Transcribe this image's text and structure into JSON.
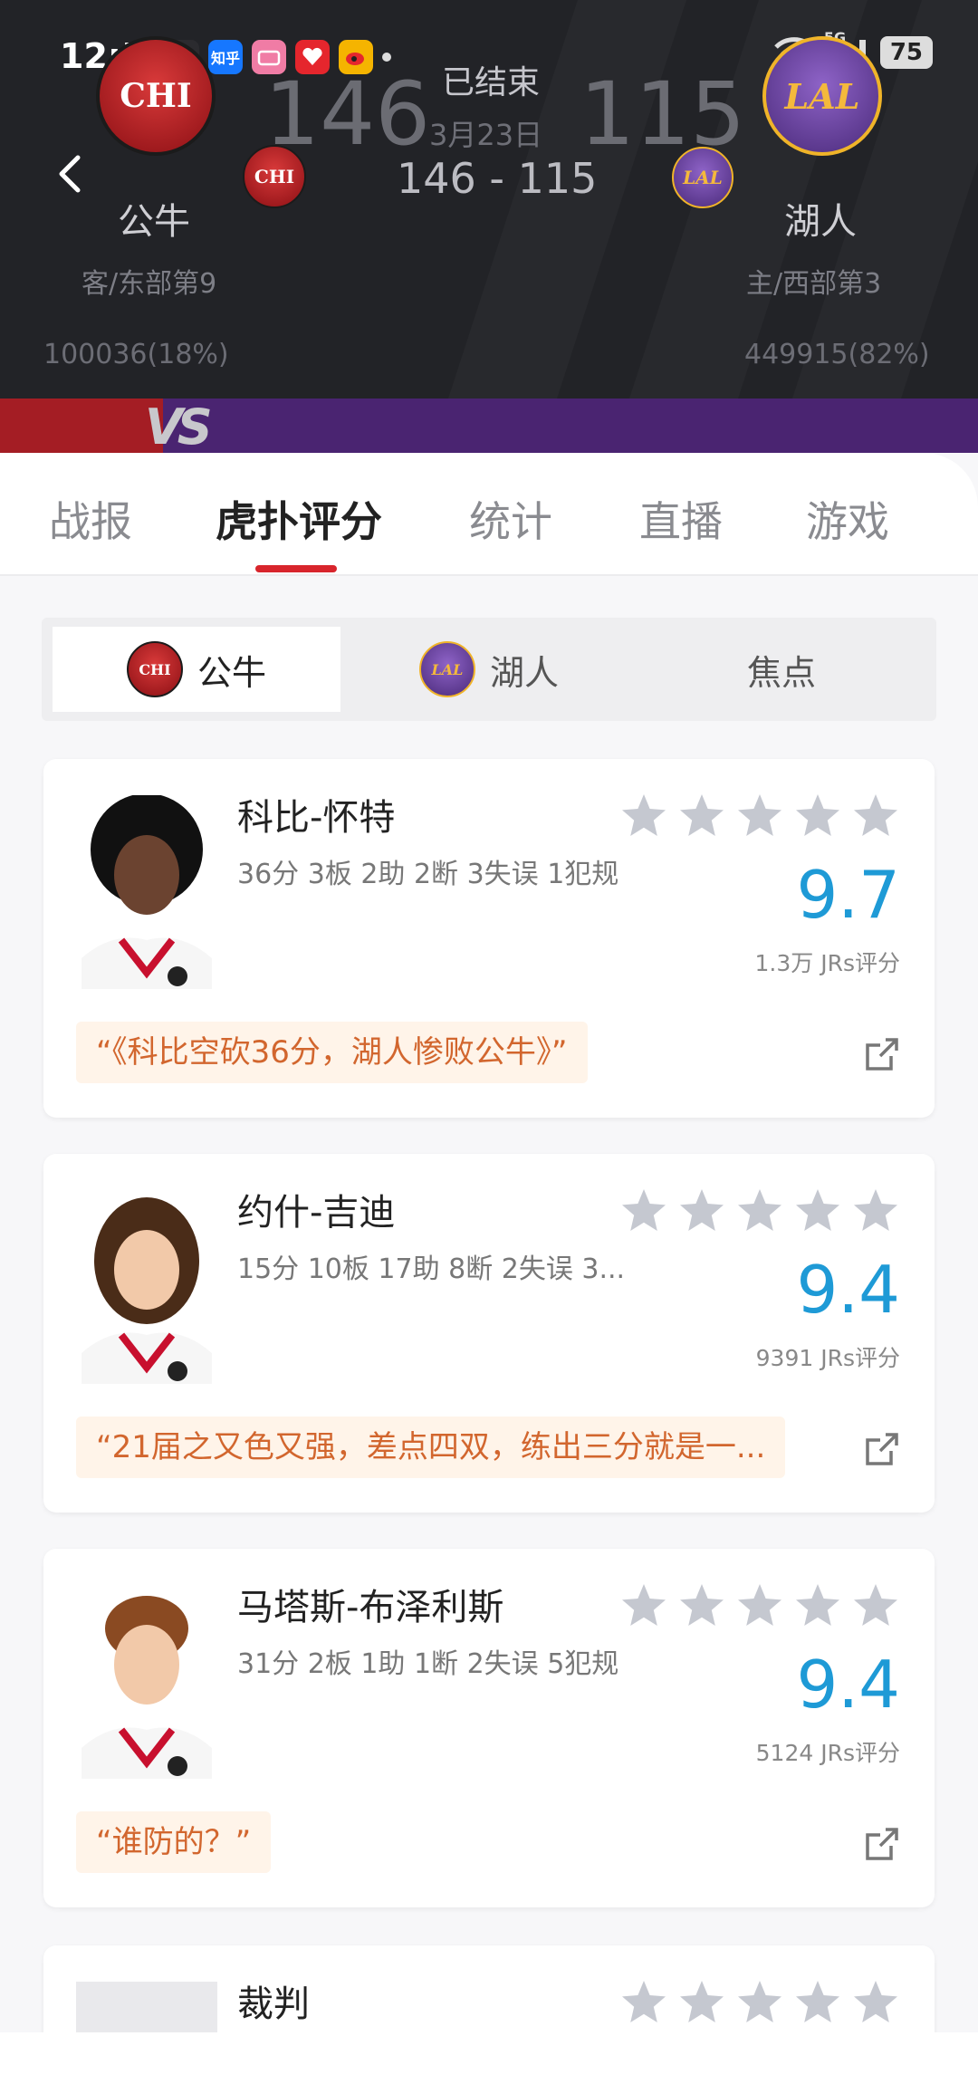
{
  "status_bar": {
    "time": "12:59",
    "network": "5G",
    "battery": "75",
    "apps": [
      {
        "name": "wechat-icon",
        "label": ""
      },
      {
        "name": "zhihu-icon",
        "label": "知乎"
      },
      {
        "name": "bilibili-icon",
        "label": ""
      },
      {
        "name": "app-red-icon",
        "label": ""
      },
      {
        "name": "weibo-icon",
        "label": ""
      }
    ]
  },
  "game": {
    "status": "已结束",
    "date": "3月23日",
    "away": {
      "abbr": "CHI",
      "name": "公牛",
      "rank": "客/东部第9",
      "votes": "100036(18%)",
      "score": "146"
    },
    "home": {
      "abbr": "LAL",
      "name": "湖人",
      "rank": "主/西部第3",
      "votes": "449915(82%)",
      "score": "115"
    },
    "compact_score": "146 - 115",
    "vs": "VS"
  },
  "tabs": [
    "战报",
    "虎扑评分",
    "统计",
    "直播",
    "游戏"
  ],
  "active_tab": 1,
  "segments": [
    {
      "label": "公牛",
      "logo": "CHI"
    },
    {
      "label": "湖人",
      "logo": "LAL"
    },
    {
      "label": "焦点",
      "logo": ""
    }
  ],
  "active_segment": 0,
  "players": [
    {
      "name": "科比-怀特",
      "stats": "36分 3板 2助 2断 3失误 1犯规",
      "score": "9.7",
      "rating_count": "1.3万 JRs评分",
      "quote": "“《科比空砍36分，湖人惨败公牛》”",
      "stars": 5,
      "hair": "afro"
    },
    {
      "name": "约什-吉迪",
      "stats": "15分 10板 17助 8断 2失误 3...",
      "score": "9.4",
      "rating_count": "9391 JRs评分",
      "quote": "“21届之又色又强，差点四双，练出三分就是一...",
      "stars": 5,
      "hair": "long"
    },
    {
      "name": "马塔斯-布泽利斯",
      "stats": "31分 2板 1助 1断 2失误 5犯规",
      "score": "9.4",
      "rating_count": "5124 JRs评分",
      "quote": "“谁防的？”",
      "stars": 5,
      "hair": "short"
    },
    {
      "name": "裁判",
      "stats": "",
      "score": "",
      "rating_count": "",
      "quote": "",
      "stars": 5,
      "hair": "none"
    }
  ],
  "colors": {
    "accent": "#d8252c",
    "score_blue": "#1e9ad6",
    "quote_text": "#d2662e",
    "chi_red": "#a41d24",
    "lal_purple": "#4a2471"
  }
}
